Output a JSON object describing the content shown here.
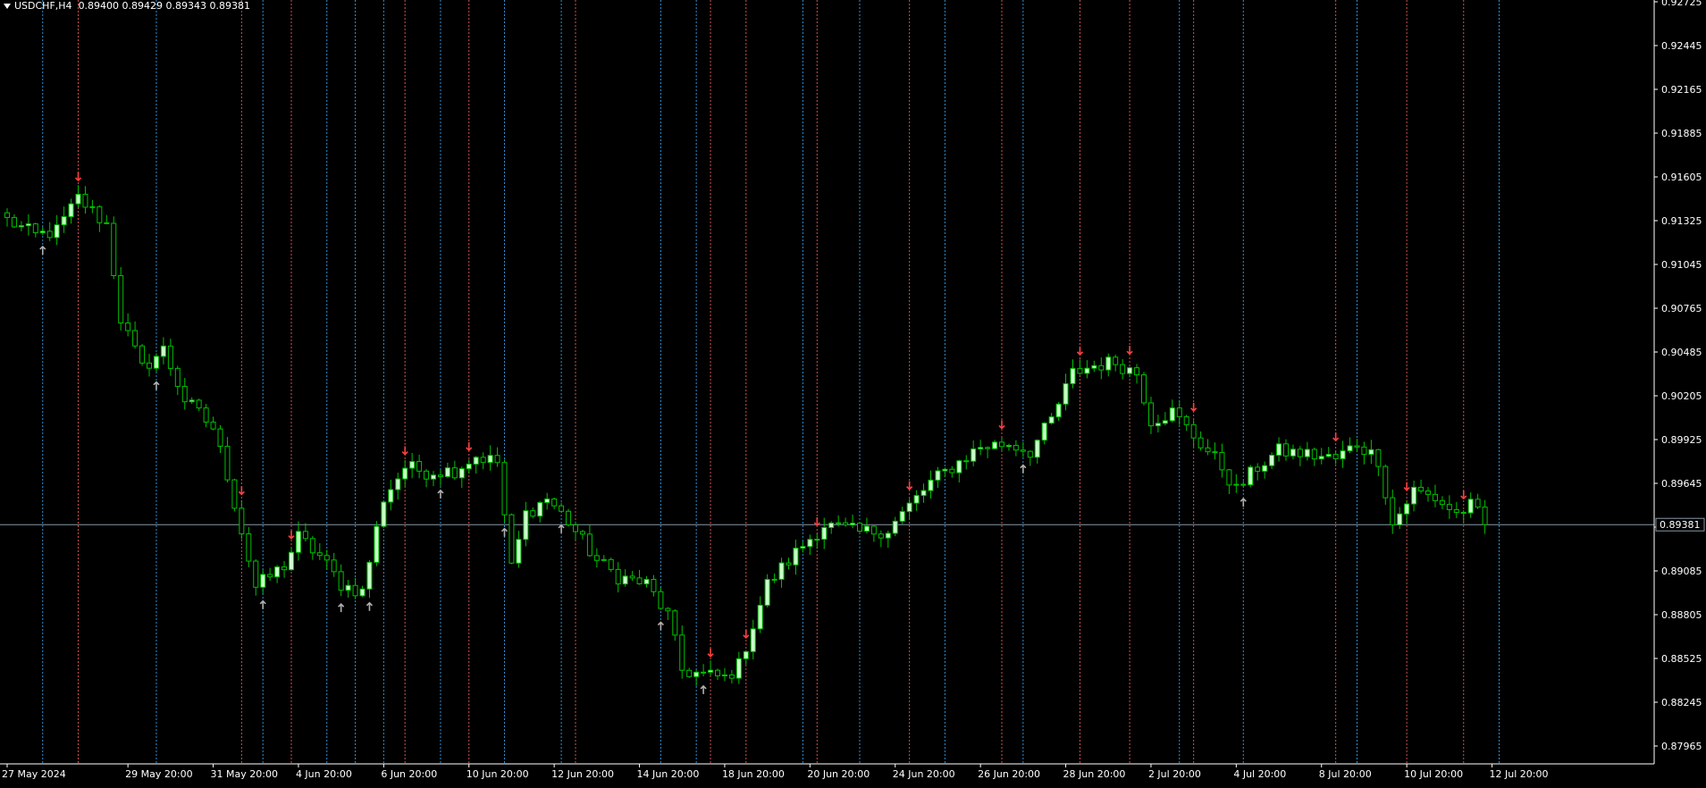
{
  "header": {
    "symbol_tf": "USDCHF,H4",
    "ohlc": "0.89400 0.89429 0.89343 0.89381"
  },
  "colors": {
    "background": "#000000",
    "bull_body": "#c8ffc8",
    "bear_body": "#000000",
    "wick": "#00c000",
    "axis": "#ffffff",
    "grid_blue": "#2f8fd0",
    "grid_red": "#d05050",
    "bid_line": "#8899aa",
    "arrow_down": "#ff4040",
    "arrow_up": "#b0b0b0"
  },
  "chart_data": {
    "type": "candlestick",
    "symbol": "USDCHF",
    "timeframe": "H4",
    "ylim": [
      0.87895,
      0.92745
    ],
    "y_ticks": [
      "0.92725",
      "0.92445",
      "0.92165",
      "0.91885",
      "0.91605",
      "0.91325",
      "0.91045",
      "0.90765",
      "0.90485",
      "0.90205",
      "0.89925",
      "0.89645",
      "0.89365",
      "0.89085",
      "0.88805",
      "0.88525",
      "0.88245",
      "0.87965"
    ],
    "x_ticks": [
      {
        "label": "27 May 2024",
        "bar": 0
      },
      {
        "label": "29 May 20:00",
        "bar": 17
      },
      {
        "label": "31 May 20:00",
        "bar": 29
      },
      {
        "label": "4 Jun 20:00",
        "bar": 41
      },
      {
        "label": "6 Jun 20:00",
        "bar": 53
      },
      {
        "label": "10 Jun 20:00",
        "bar": 65
      },
      {
        "label": "12 Jun 20:00",
        "bar": 77
      },
      {
        "label": "14 Jun 20:00",
        "bar": 89
      },
      {
        "label": "18 Jun 20:00",
        "bar": 101
      },
      {
        "label": "20 Jun 20:00",
        "bar": 113
      },
      {
        "label": "24 Jun 20:00",
        "bar": 125
      },
      {
        "label": "26 Jun 20:00",
        "bar": 137
      },
      {
        "label": "28 Jun 20:00",
        "bar": 149
      },
      {
        "label": "2 Jul 20:00",
        "bar": 161
      },
      {
        "label": "4 Jul 20:00",
        "bar": 173
      },
      {
        "label": "8 Jul 20:00",
        "bar": 185
      },
      {
        "label": "10 Jul 20:00",
        "bar": 197
      },
      {
        "label": "12 Jul 20:00",
        "bar": 209
      }
    ],
    "current_price": "0.89381",
    "trough_bar": 101,
    "anchors": [
      [
        0,
        0.9133
      ],
      [
        4,
        0.9123
      ],
      [
        7,
        0.9126
      ],
      [
        10,
        0.9147
      ],
      [
        14,
        0.913
      ],
      [
        16,
        0.907
      ],
      [
        19,
        0.9038
      ],
      [
        22,
        0.905
      ],
      [
        25,
        0.9018
      ],
      [
        29,
        0.9
      ],
      [
        31,
        0.897
      ],
      [
        35,
        0.8898
      ],
      [
        39,
        0.8912
      ],
      [
        41,
        0.893
      ],
      [
        44,
        0.8918
      ],
      [
        47,
        0.89
      ],
      [
        50,
        0.8895
      ],
      [
        53,
        0.8955
      ],
      [
        56,
        0.8975
      ],
      [
        59,
        0.8972
      ],
      [
        63,
        0.8973
      ],
      [
        66,
        0.8982
      ],
      [
        69,
        0.8978
      ],
      [
        71,
        0.891
      ],
      [
        73,
        0.8945
      ],
      [
        76,
        0.8955
      ],
      [
        79,
        0.894
      ],
      [
        83,
        0.8915
      ],
      [
        86,
        0.8905
      ],
      [
        90,
        0.89
      ],
      [
        93,
        0.888
      ],
      [
        95,
        0.8845
      ],
      [
        98,
        0.8842
      ],
      [
        101,
        0.884
      ],
      [
        103,
        0.8848
      ],
      [
        107,
        0.89
      ],
      [
        112,
        0.8925
      ],
      [
        115,
        0.8938
      ],
      [
        120,
        0.8933
      ],
      [
        124,
        0.8935
      ],
      [
        127,
        0.895
      ],
      [
        130,
        0.8965
      ],
      [
        133,
        0.8975
      ],
      [
        137,
        0.8988
      ],
      [
        141,
        0.899
      ],
      [
        144,
        0.8985
      ],
      [
        147,
        0.9005
      ],
      [
        150,
        0.9035
      ],
      [
        153,
        0.904
      ],
      [
        156,
        0.9042
      ],
      [
        159,
        0.9035
      ],
      [
        161,
        0.9005
      ],
      [
        164,
        0.901
      ],
      [
        167,
        0.8995
      ],
      [
        171,
        0.8975
      ],
      [
        173,
        0.896
      ],
      [
        176,
        0.8975
      ],
      [
        179,
        0.8985
      ],
      [
        183,
        0.8983
      ],
      [
        187,
        0.898
      ],
      [
        190,
        0.899
      ],
      [
        193,
        0.898
      ],
      [
        195,
        0.8938
      ],
      [
        198,
        0.896
      ],
      [
        201,
        0.8955
      ],
      [
        204,
        0.8945
      ],
      [
        206,
        0.895
      ],
      [
        208,
        0.894
      ]
    ],
    "fractal_down_bars": [
      10,
      33,
      40,
      56,
      65,
      99,
      104,
      114,
      127,
      140,
      151,
      158,
      167,
      187,
      197,
      205
    ],
    "fractal_up_bars": [
      5,
      21,
      36,
      47,
      51,
      61,
      70,
      78,
      92,
      98,
      143,
      174,
      210
    ],
    "red_vlines": [
      10,
      33,
      40,
      56,
      65,
      80,
      99,
      104,
      114,
      127,
      140,
      151,
      158,
      167,
      187,
      197,
      205
    ],
    "blue_vlines": [
      5,
      21,
      36,
      45,
      49,
      53,
      61,
      70,
      78,
      92,
      97,
      112,
      120,
      132,
      143,
      165,
      174,
      190,
      210
    ]
  }
}
